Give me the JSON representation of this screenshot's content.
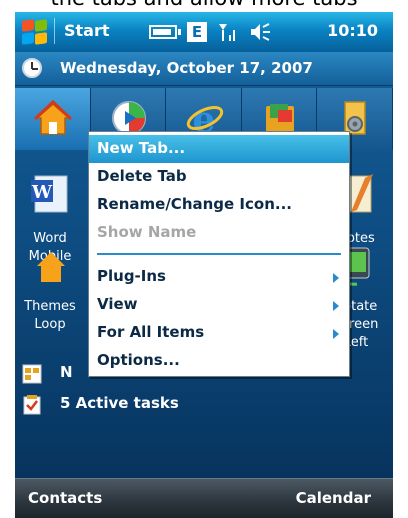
{
  "caption": {
    "text": "the tabs and allow more tabs"
  },
  "titlebar": {
    "start_label": "Start",
    "clock": "10:10",
    "icons": [
      "battery-icon",
      "edge-network-icon",
      "signal-strength-icon",
      "volume-icon"
    ],
    "edge_letter": "E"
  },
  "today": {
    "date": "Wednesday, October 17, 2007",
    "tabs": [
      "home-icon",
      "media-player-icon",
      "internet-explorer-icon",
      "games-icon",
      "settings-folder-icon"
    ],
    "apps": [
      {
        "icon": "word-mobile-icon",
        "label": "Word Mobile"
      },
      {
        "icon": "notes-icon",
        "label": "Notes"
      },
      {
        "icon": "themes-icon",
        "label": "Themes Loop"
      },
      {
        "icon": "rotate-screen-icon",
        "label": "Rotate Screen Left"
      }
    ],
    "items": [
      {
        "icon": "calendar-icon",
        "text": "N"
      },
      {
        "icon": "tasks-icon",
        "text": "5 Active tasks"
      }
    ]
  },
  "softkeys": {
    "left": "Contacts",
    "right": "Calendar"
  },
  "menu": {
    "items": [
      {
        "label": "New Tab...",
        "state": "selected",
        "submenu": false
      },
      {
        "label": "Delete Tab",
        "state": "normal",
        "submenu": false
      },
      {
        "label": "Rename/Change Icon...",
        "state": "normal",
        "submenu": false
      },
      {
        "label": "Show Name",
        "state": "disabled",
        "submenu": false
      },
      {
        "label": "Plug-Ins",
        "state": "normal",
        "submenu": true
      },
      {
        "label": "View",
        "state": "normal",
        "submenu": true
      },
      {
        "label": "For All Items",
        "state": "normal",
        "submenu": true
      },
      {
        "label": "Options...",
        "state": "normal",
        "submenu": false
      }
    ]
  },
  "colors": {
    "accent": "#1e95cf",
    "menu_text": "#0c2a45",
    "disabled": "#a6a6a6"
  }
}
